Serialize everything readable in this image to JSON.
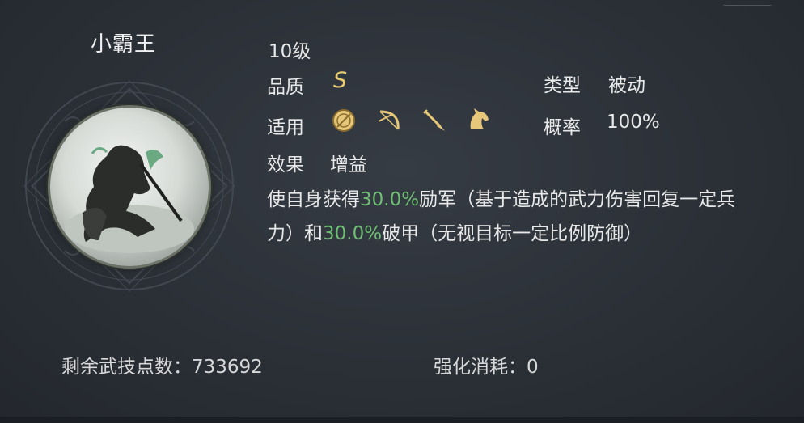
{
  "skill": {
    "name": "小霸王",
    "level": "10级",
    "quality_label": "品质",
    "quality_value": "S",
    "type_label": "类型",
    "type_value": "被动",
    "applies_label": "适用",
    "applies_icons": [
      "shield-icon",
      "bow-icon",
      "spear-icon",
      "horse-icon"
    ],
    "rate_label": "概率",
    "rate_value": "100%",
    "effect_label": "效果",
    "effect_value": "增益",
    "description": {
      "p1": "使自身获得",
      "v1": "30.0%",
      "p2": "励军（基于造成的武力伤害回复一定兵力）和",
      "v2": "30.0%",
      "p3": "破甲（无视目标一定比例防御）"
    }
  },
  "footer": {
    "remaining_points": "剩余武技点数：733692",
    "upgrade_cost": "强化消耗：0"
  },
  "colors": {
    "highlight": "#6fbf73",
    "grade": "#e9cc72",
    "icon_gold": "#e7c77a"
  }
}
